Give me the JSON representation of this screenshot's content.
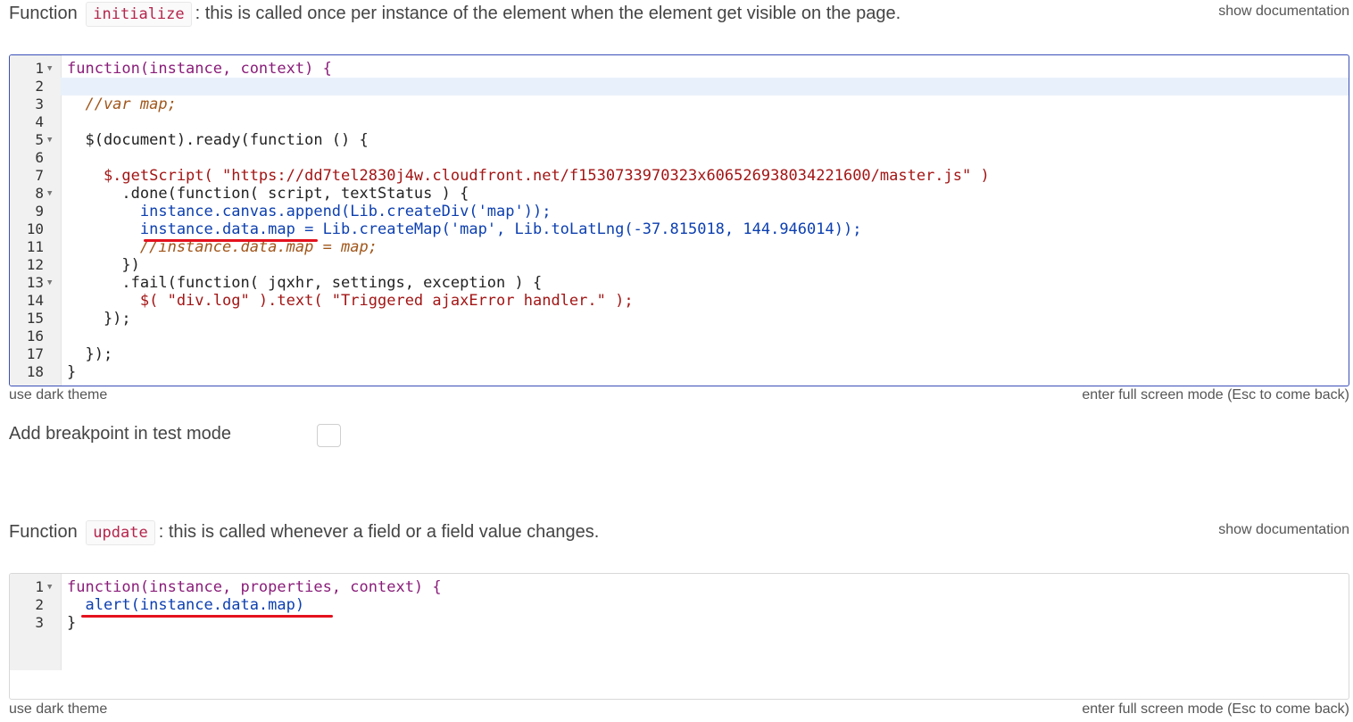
{
  "init_section": {
    "label_prefix": "Function",
    "fn_name": "initialize",
    "description": ": this is called once per instance of the element when the element get visible on the page.",
    "doc_link": "show documentation",
    "code_lines": [
      "function(instance, context) {",
      "",
      "  //var map;",
      "",
      "  $(document).ready(function () {",
      "",
      "    $.getScript( \"https://dd7tel2830j4w.cloudfront.net/f1530733970323x606526938034221600/master.js\" )",
      "      .done(function( script, textStatus ) {",
      "        instance.canvas.append(Lib.createDiv('map'));",
      "        instance.data.map = Lib.createMap('map', Lib.toLatLng(-37.815018, 144.946014));",
      "        //instance.data.map = map;",
      "      })",
      "      .fail(function( jqxhr, settings, exception ) {",
      "        $( \"div.log\" ).text( \"Triggered ajaxError handler.\" );",
      "    });",
      "",
      "  });",
      "}"
    ],
    "dark_theme_link": "use dark theme",
    "fullscreen_link": "enter full screen mode (Esc to come back)"
  },
  "breakpoint": {
    "label": "Add breakpoint in test mode",
    "checked": false
  },
  "update_section": {
    "label_prefix": "Function",
    "fn_name": "update",
    "description": ": this is called whenever a field or a field value changes.",
    "doc_link": "show documentation",
    "code_lines": [
      "function(instance, properties, context) {",
      "  alert(instance.data.map)",
      "}"
    ],
    "dark_theme_link": "use dark theme",
    "fullscreen_link": "enter full screen mode (Esc to come back)"
  },
  "colors": {
    "keyword": "#8a1d7a",
    "variable": "#0c3fb0",
    "string": "#a31515",
    "number": "#116644",
    "comment": "#a0561a",
    "annotation_underline": "#e4121e",
    "focus_border": "#3a4fb8"
  }
}
